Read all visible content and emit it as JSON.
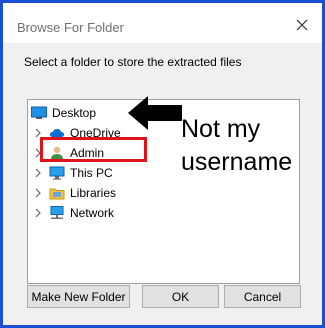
{
  "window": {
    "title": "Browse For Folder",
    "close_icon": "close-icon"
  },
  "instruction": "Select a folder to store the extracted files",
  "tree": {
    "items": [
      {
        "label": "Desktop",
        "icon": "desktop-icon",
        "expandable": false
      },
      {
        "label": "OneDrive",
        "icon": "cloud-icon",
        "expandable": true
      },
      {
        "label": "Admin",
        "icon": "user-icon",
        "expandable": true
      },
      {
        "label": "This PC",
        "icon": "computer-icon",
        "expandable": true
      },
      {
        "label": "Libraries",
        "icon": "libraries-icon",
        "expandable": true
      },
      {
        "label": "Network",
        "icon": "network-icon",
        "expandable": true
      }
    ]
  },
  "annotation": {
    "text_line1": "Not my",
    "text_line2": "username",
    "highlight_color": "#e0121a"
  },
  "buttons": {
    "new_folder": "Make New Folder",
    "ok": "OK",
    "cancel": "Cancel"
  },
  "colors": {
    "frame": "#1a4fd6",
    "dialog_bg": "#f0f0f0",
    "button_bg": "#e1e1e1"
  }
}
